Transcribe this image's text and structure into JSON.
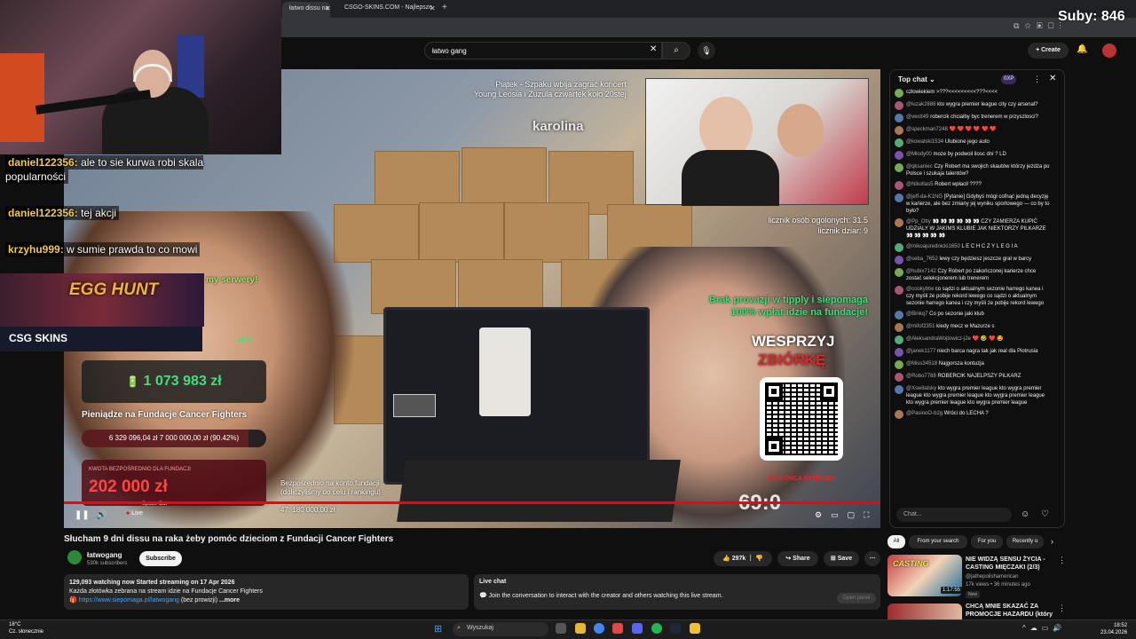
{
  "browser": {
    "tabs": [
      {
        "label": "łatwo dissu na"
      },
      {
        "label": "CSGO-SKINS.COM - Najlepsze"
      }
    ],
    "new_tab": "+"
  },
  "stream_overlay": {
    "subs": "Suby: 846"
  },
  "youtube": {
    "search": {
      "value": "łatwo gang"
    },
    "create": "Create"
  },
  "video": {
    "notice": [
      "Piątek - Szpaku wbija zagrać koncert",
      "Young Leosia i Zuzula czwartek koło 20stej"
    ],
    "karolina": "karolina",
    "counter_total": "licznik osób ogolonych: 31.5",
    "counter_girls": "licznik dziar: 9",
    "brak": [
      "Brak prowizji w tipply i siepomaga",
      "100% wpłat idzie na fundacje!"
    ],
    "wesprzyj": "WESPRZYJ",
    "zbiorke": "ZBIÓRKĘ",
    "do_konca": "DO KOŃCA STREAMA",
    "timer": "69:0",
    "egg_hunt": "EGG HUNT",
    "serwery": "my serwery!",
    "csgo": "CSG SKINS",
    "csgo_value": "10 zł",
    "amount": "1 073 983 zł",
    "foundation": "Pieniądze na Fundacje Cancer Fighters",
    "progress_text": "6 329 096,04 zł 7 000 000,00 zł (90.42%)",
    "progress_pct": 90.42,
    "kwota_label": "KWOTA BEZPOŚREDNIO DLA FUNDACJI",
    "kwota_value": "202 000 zł",
    "bezp": [
      "Bezpośrednio na konto fundacji",
      "(doliczyliśmy do celu i rankingu)",
      "47: 180 000,00 zł"
    ],
    "space_cat": "Space Cat",
    "live": "Live"
  },
  "overlay_chat": [
    {
      "name": "daniel122356:",
      "text": "ale to sie kurwa robi skala popularności"
    },
    {
      "name": "daniel122356:",
      "text": "tej akcji"
    },
    {
      "name": "krzyhu999:",
      "text": "w sumie prawda to co mowi"
    }
  ],
  "under_video": {
    "title": "Słucham 9 dni dissu na raka żeby pomóc dzieciom z Fundacji Cancer Fighters",
    "channel": "łatwogang",
    "subs": "530k subscribers",
    "subscribe": "Subscribe",
    "likes": "297k",
    "share": "Share",
    "save": "Save",
    "desc_stats": "129,093 watching now  Started streaming on 17 Apr 2026",
    "desc_line": "Każda złotówka zebrana na stream idzie na Fundacje Cancer Fighters",
    "desc_url": "https://www.siepomaga.pl/latwogang",
    "desc_rest": "(bez prowizji)",
    "more": "...more",
    "live_chat_title": "Live chat",
    "live_chat_text": "Join the conversation to interact with the creator and others watching this live stream.",
    "open_panel": "Open panel"
  },
  "chat": {
    "header": "Top chat",
    "xp": "0XP",
    "input_placeholder": "Chat...",
    "messages": [
      {
        "name": "",
        "text": "człowiekiem >???<<<<<<<<<???<<<<"
      },
      {
        "name": "@luzak2886",
        "text": "kto wygra premier league city czy arsenal?"
      },
      {
        "name": "@vestt49",
        "text": "robercik chcialby byc trenerem w przyszlosci?"
      },
      {
        "name": "@speckman7248",
        "text": "❤️ ❤️ ❤️ ❤️ ❤️ ❤️"
      },
      {
        "name": "@kowalski1534",
        "text": "Ulubione jego auto"
      },
      {
        "name": "@Mlody00",
        "text": "moze by podwoil ilosc dni ? LD"
      },
      {
        "name": "@qksaniec",
        "text": "Czy Robert ma swojich skautów którzy jeżdża po Polsce i szukaja talentów?"
      },
      {
        "name": "@Nikollas5",
        "text": "Robert wpłacił ????"
      },
      {
        "name": "@jeff-da-K1NG",
        "text": "[Pytanie] Gdybyś mógł cofnąć jedną decyzję w karierze, ale bez zmiany jej wyniku sportowego — co by to było?"
      },
      {
        "name": "@Pp_Otty",
        "text": "👀 👀 👀 👀 👀 👀 CZY ZAMIERZA KUPIĆ UDZIALY W JAKIMS KLUBIE JAK NIEKTORZY PILKARZE 👀 👀 👀 👀 👀"
      },
      {
        "name": "@mikoajurednicki1650",
        "text": "L E C H  C Z Y  L E G I A"
      },
      {
        "name": "@seba_7652",
        "text": "lewy czy będziesz jeszcze grał w barcy"
      },
      {
        "name": "@hubix7142",
        "text": "Czy Robert po zakończonej karierze chce zostać selekcjonerem lub trenerem"
      },
      {
        "name": "@cookybtw",
        "text": "co sądzi o aktualnym sezonie harrego kanea i czy myśli że pobije rekord lewego co sądzi o aktualnym sezonie harrego kanea i czy myśli że pobije rekord lewego"
      },
      {
        "name": "@Binkq7",
        "text": "Co po sezonie jaki klub"
      },
      {
        "name": "@mifof2351",
        "text": "kiedy mecz w Mazurze s"
      },
      {
        "name": "@AleksandraWojtowicz-j2e",
        "text": "❤️ 🤣 ❤️ 🤩"
      },
      {
        "name": "@janek1177",
        "text": "niech barca nagra tak jak real dla Piotrusia"
      },
      {
        "name": "@Miss34518",
        "text": "Najgorsza kontuzja"
      },
      {
        "name": "@Robo7788",
        "text": "ROBERCIK NAJELPSZY PILKARZ"
      },
      {
        "name": "@Xswitalsky",
        "text": "kto wygra premier league kto wygra premier league kto wygra premier league kto wygra premier league kto wygra premier league kto wygra premier league"
      },
      {
        "name": "@PasiooO-b2g",
        "text": "Wróci do LECHA ?"
      }
    ]
  },
  "recs": {
    "chips": [
      "All",
      "From your search",
      "For you",
      "Recently u"
    ],
    "items": [
      {
        "thumb_label": "CASTING",
        "duration": "1:17:55",
        "title": "NIE WIDZĄ SENSU ŻYCIA - CASTING MIĘCZAKI (2/3)",
        "channel": "@jathepolishamerican",
        "meta": "17k views • 36 minutes ago",
        "badge": "New"
      },
      {
        "title": "CHCĄ MNIE SKAZAĆ ZA PROMOCJE HAZARDU (który"
      }
    ]
  },
  "taskbar": {
    "temp": "18°C",
    "weather": "Cz. słonecznie",
    "search": "Wyszukaj",
    "time": "18:52",
    "date": "23.04.2026"
  }
}
